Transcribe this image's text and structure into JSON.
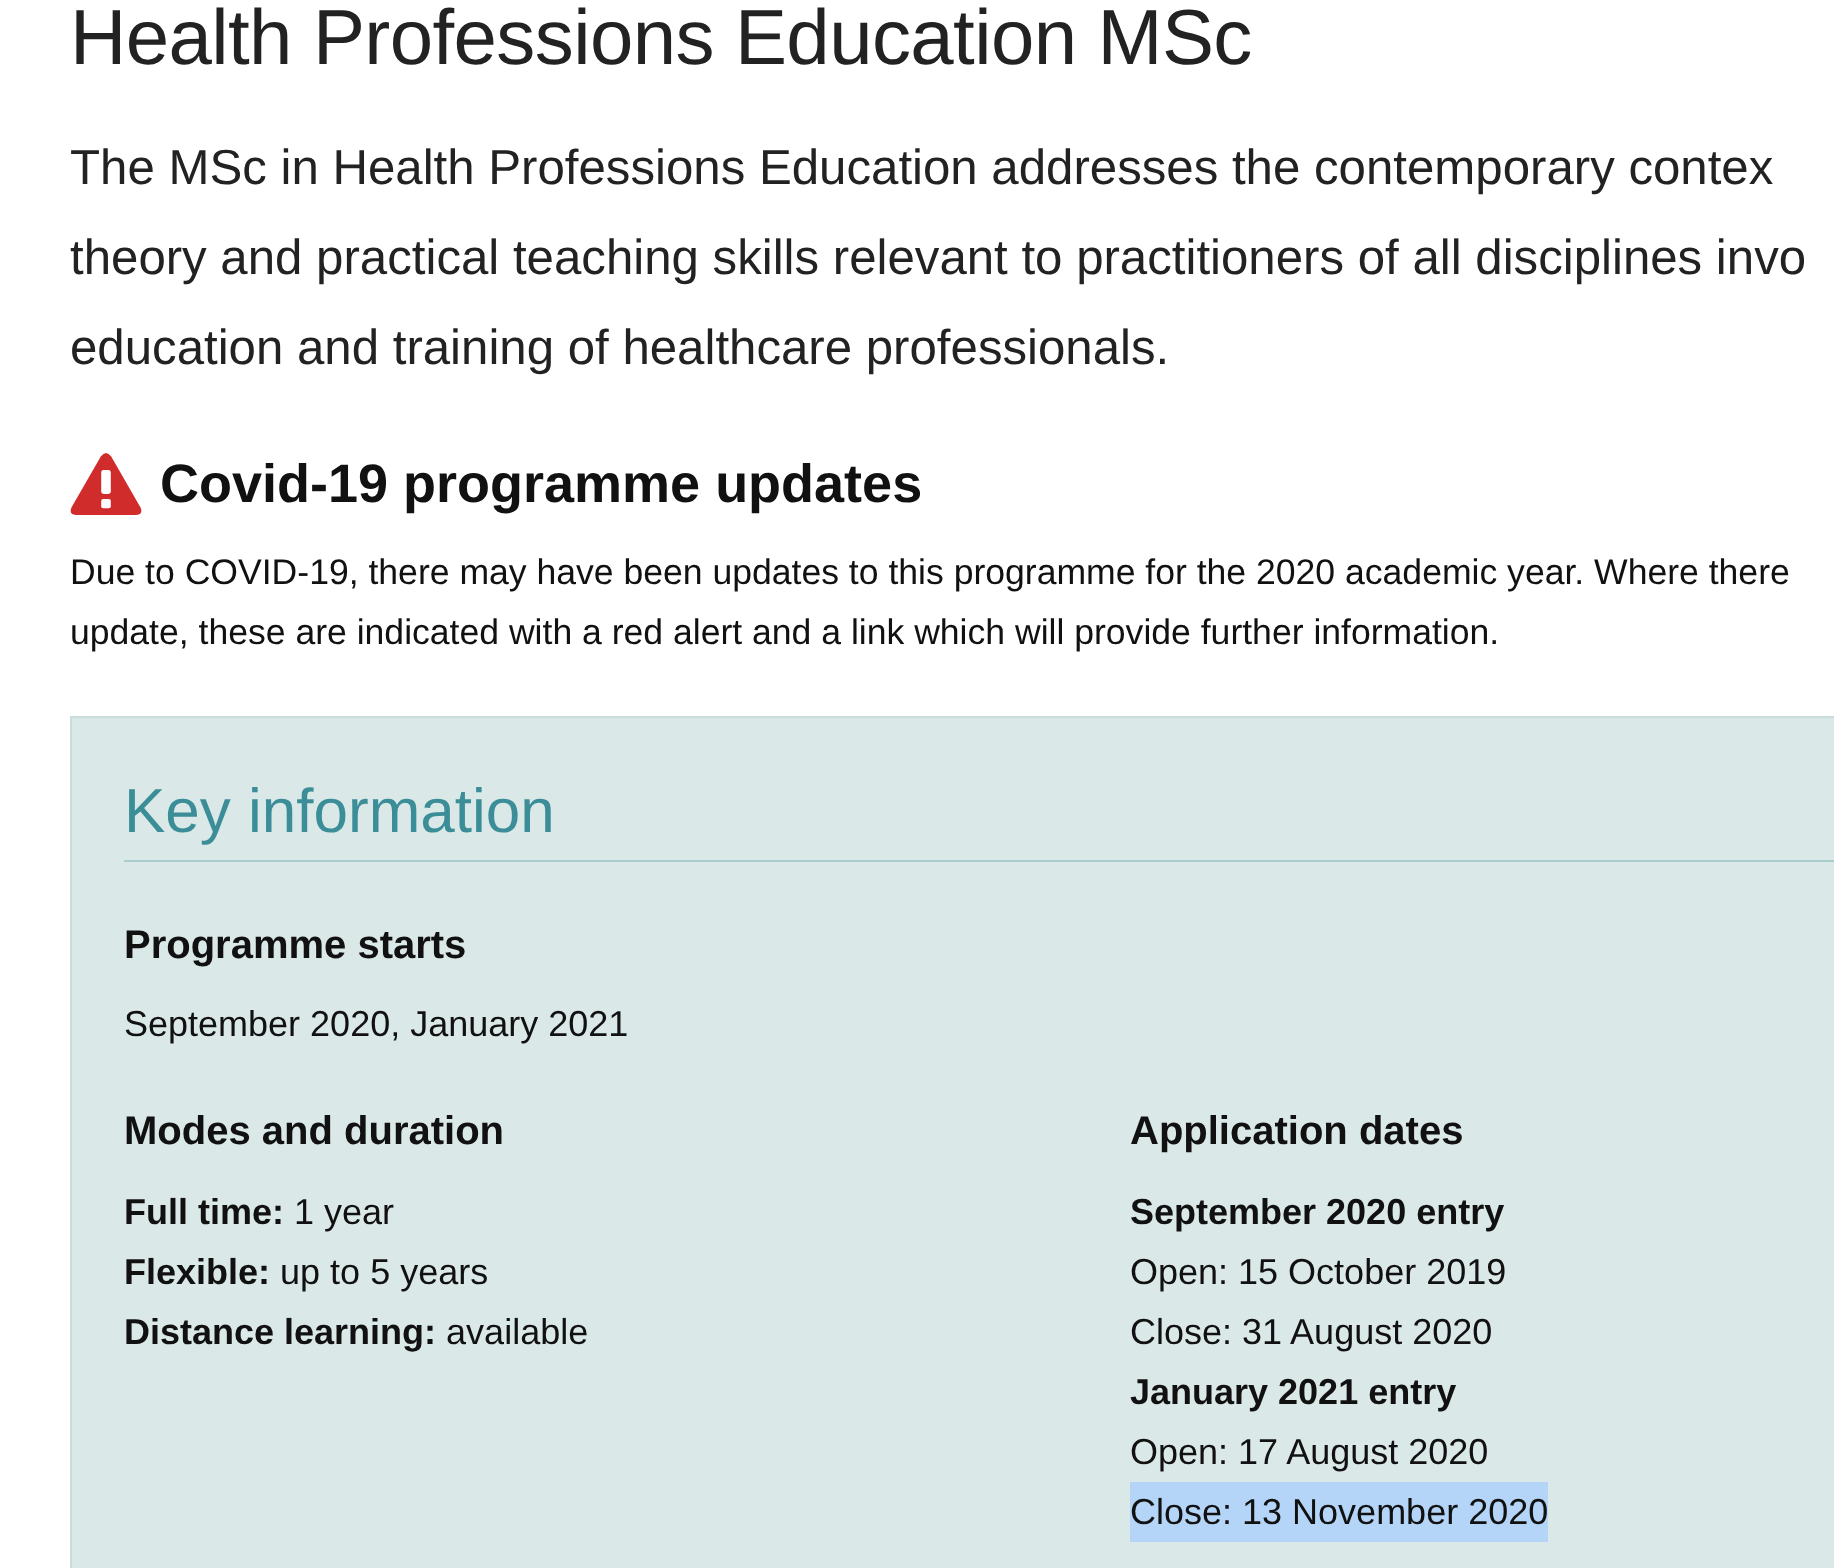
{
  "page_title": "Health Professions Education MSc",
  "intro": {
    "lines": [
      "The MSc in Health Professions Education addresses the contemporary contex",
      "theory and practical teaching skills relevant to practitioners of all disciplines invo",
      "education and training of healthcare professionals."
    ]
  },
  "covid_notice": {
    "title": "Covid-19 programme updates",
    "lines": [
      "Due to COVID-19, there may have been updates to this programme for the 2020 academic year. Where there",
      "update, these are indicated with a red alert and a link which will provide further information."
    ]
  },
  "key_information": {
    "title": "Key information",
    "programme_starts": {
      "heading": "Programme starts",
      "value": "September 2020, January 2021"
    },
    "modes_and_duration": {
      "heading": "Modes and duration",
      "items": [
        "**Full time:** 1 year",
        "**Flexible:** up to 5 years",
        "**Distance learning:** available"
      ]
    },
    "application_dates": {
      "heading": "Application dates",
      "items": [
        {
          "kind": "entry",
          "text": "September 2020 entry",
          "highlighted": false
        },
        {
          "kind": "date",
          "text": "Open: 15 October 2019",
          "highlighted": false
        },
        {
          "kind": "date",
          "text": "Close: 31 August 2020",
          "highlighted": false
        },
        {
          "kind": "entry",
          "text": "January 2021 entry",
          "highlighted": false
        },
        {
          "kind": "date",
          "text": "Open: 17 August 2020",
          "highlighted": false
        },
        {
          "kind": "date",
          "text": "Close: 13 November 2020",
          "highlighted": true
        }
      ]
    }
  }
}
